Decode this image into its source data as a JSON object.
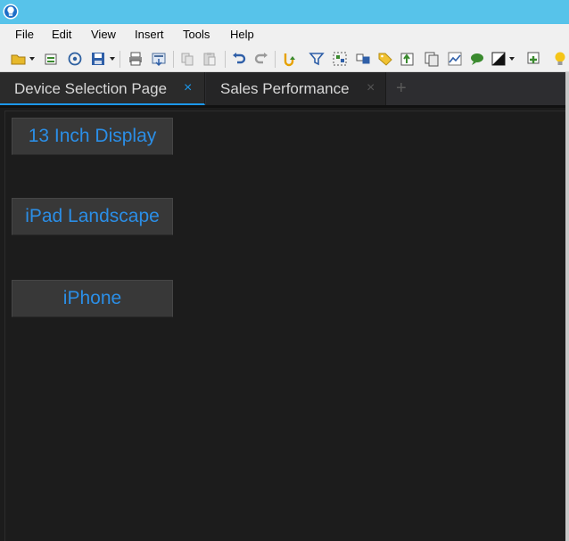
{
  "menu": {
    "items": [
      "File",
      "Edit",
      "View",
      "Insert",
      "Tools",
      "Help"
    ]
  },
  "toolbar": {
    "icons": [
      "open-folder-icon",
      "new-sheet-icon",
      "connect-data-icon",
      "save-icon",
      "print-icon",
      "export-icon",
      "copy-icon",
      "paste-icon",
      "undo-icon",
      "redo-icon",
      "refresh-icon",
      "filter-icon",
      "select-data-icon",
      "group-icon",
      "tag-icon",
      "sort-icon",
      "duplicate-icon",
      "chart-icon",
      "comment-icon",
      "theme-icon",
      "add-object-icon",
      "lightbulb-icon"
    ]
  },
  "tabs": [
    {
      "label": "Device Selection Page",
      "active": true
    },
    {
      "label": "Sales Performance",
      "active": false
    }
  ],
  "tab_add_symbol": "+",
  "tab_close_symbol": "×",
  "buttons": {
    "display13": "13 Inch Display",
    "ipad": "iPad Landscape",
    "iphone": "iPhone"
  },
  "colors": {
    "titlebar": "#57c3ea",
    "accent": "#1c97ea",
    "button_text": "#2b8ee6",
    "canvas": "#1c1c1c"
  }
}
